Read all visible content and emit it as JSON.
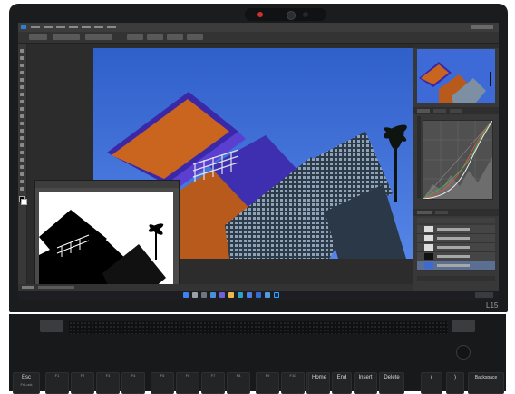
{
  "image": {
    "subject": "laptop",
    "model_label": "L15",
    "application": "photo editor",
    "colors": {
      "sky": "#3f6fd8",
      "facade_orange": "#c9651f",
      "facade_purple": "#3a28a8",
      "bezel": "#1b1c1e",
      "app_bg": "#2a2a2a"
    }
  },
  "keyboard": {
    "keys": [
      {
        "label": "Esc",
        "sub": "FnLock"
      },
      {
        "label": "",
        "sub": "F1"
      },
      {
        "label": "",
        "sub": "F2"
      },
      {
        "label": "",
        "sub": "F3"
      },
      {
        "label": "",
        "sub": "F4"
      },
      {
        "label": "",
        "sub": "F5"
      },
      {
        "label": "",
        "sub": "F6"
      },
      {
        "label": "",
        "sub": "F7"
      },
      {
        "label": "",
        "sub": "F8"
      },
      {
        "label": "",
        "sub": "F9"
      },
      {
        "label": "",
        "sub": "F10"
      },
      {
        "label": "",
        "sub": "F11"
      },
      {
        "label": "Home",
        "sub": ""
      },
      {
        "label": "End",
        "sub": ""
      },
      {
        "label": "Insert",
        "sub": ""
      },
      {
        "label": "Delete",
        "sub": ""
      },
      {
        "label": "(",
        "sub": ""
      },
      {
        "label": ")",
        "sub": ""
      },
      {
        "label": "Backspace",
        "sub": ""
      }
    ]
  }
}
